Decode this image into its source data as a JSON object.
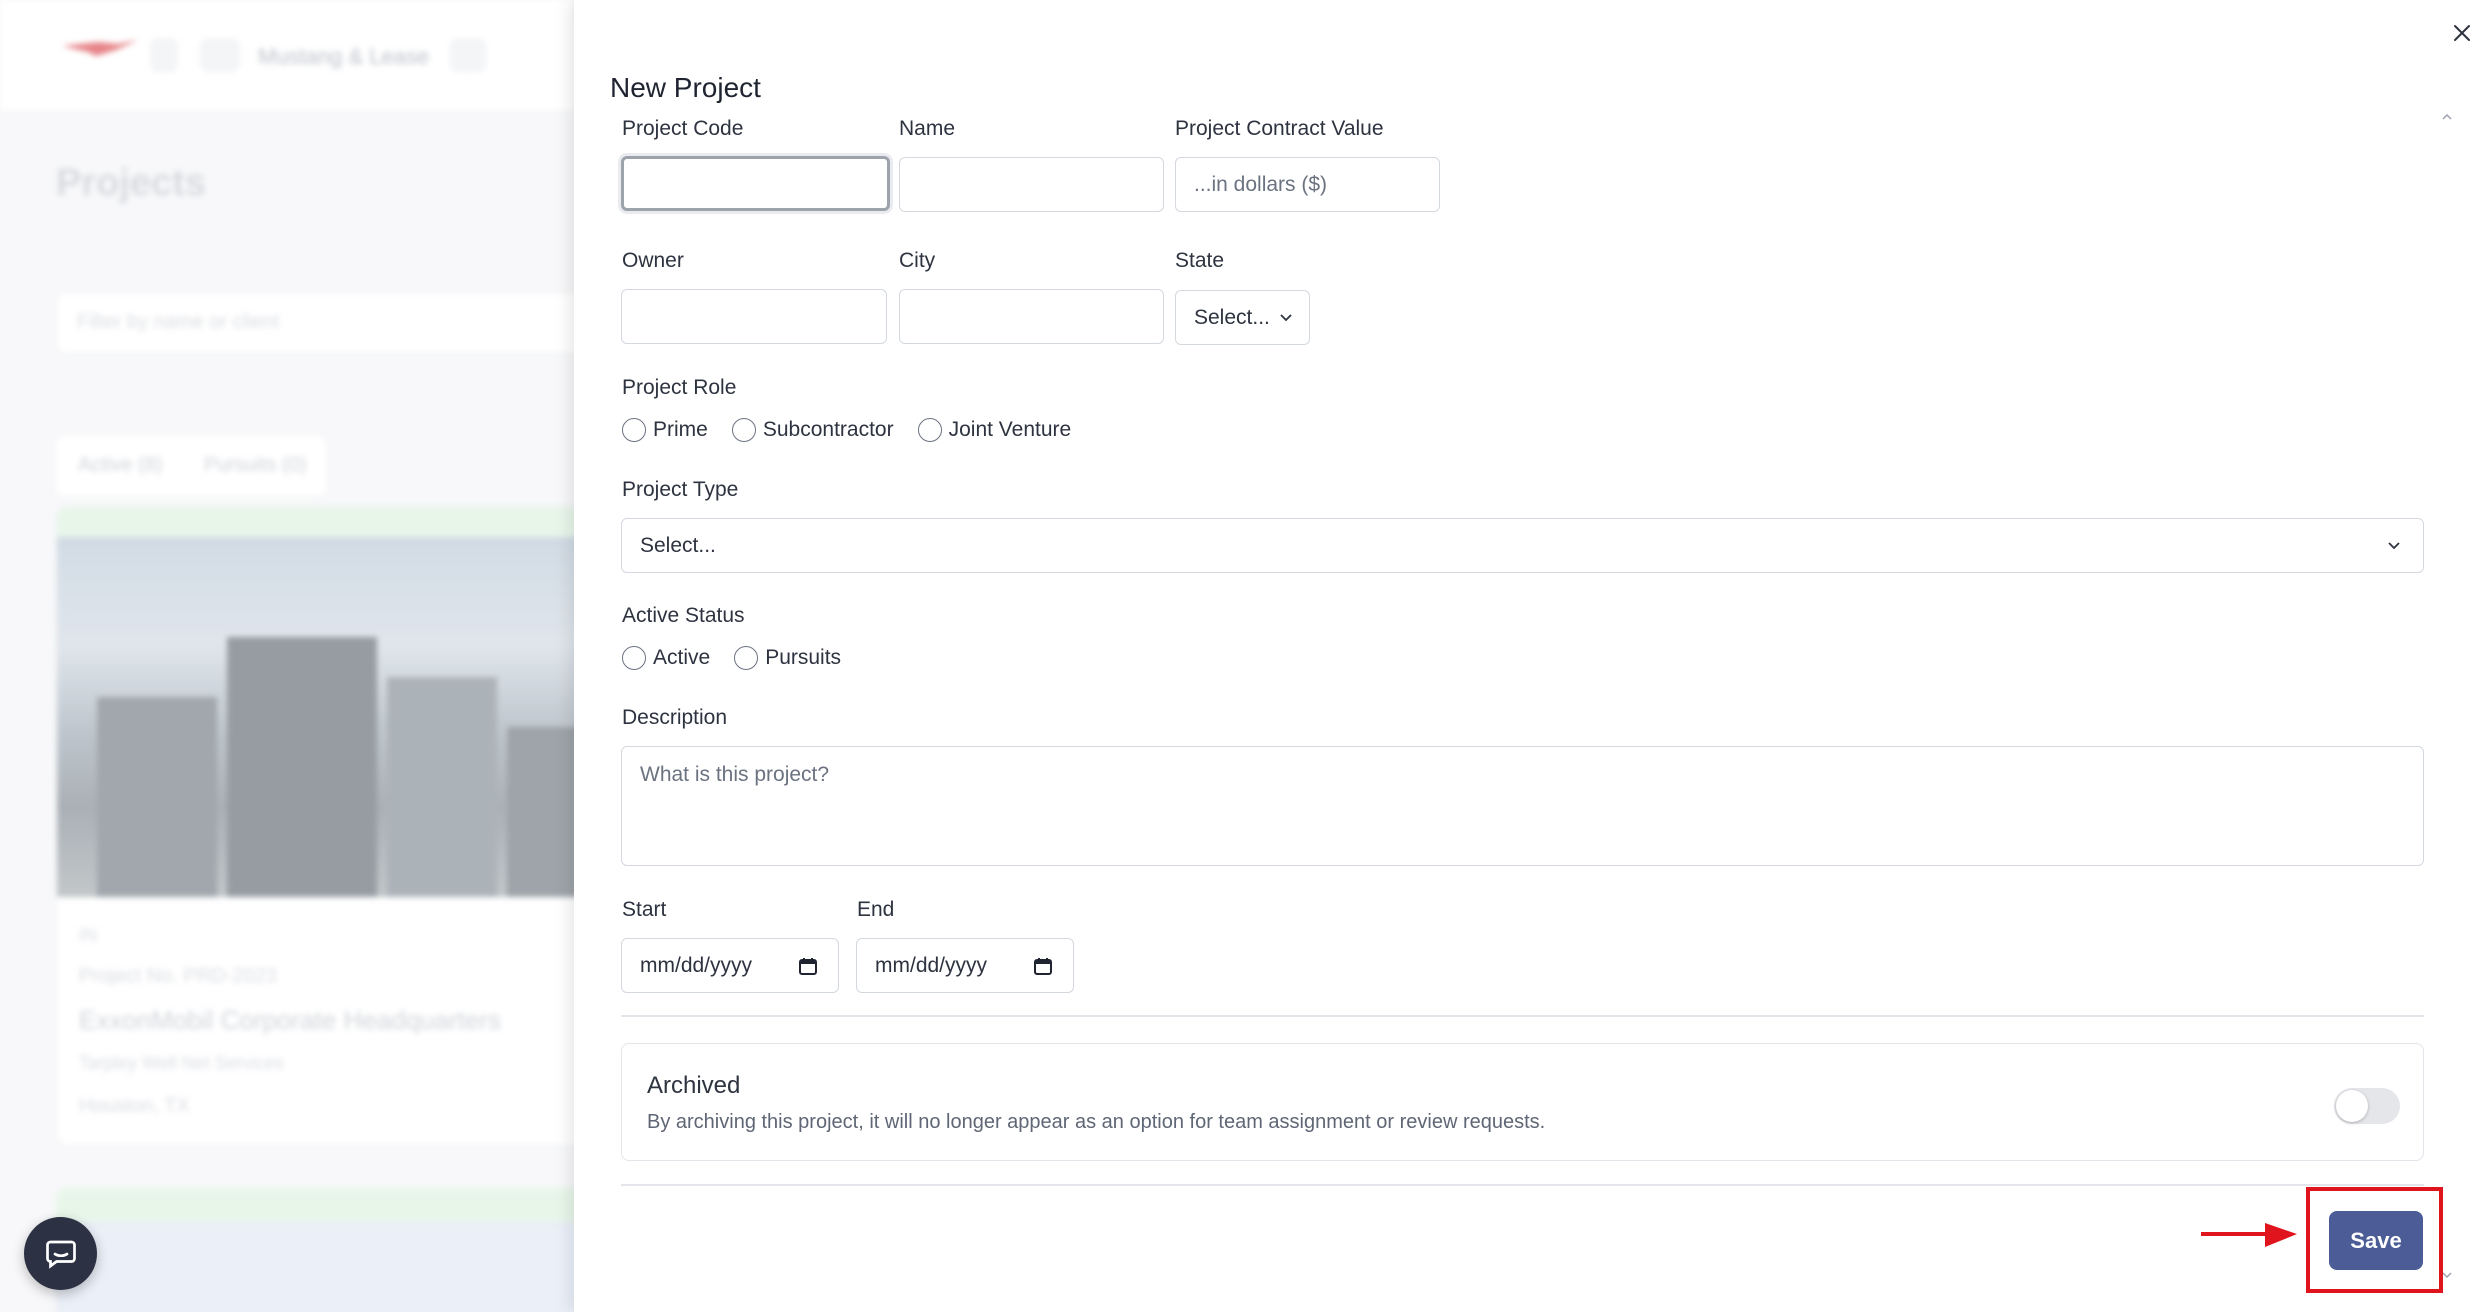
{
  "background": {
    "breadcrumb": "Mustang & Lease",
    "page_title": "Projects",
    "search_placeholder": "Filter by name or client",
    "tabs": [
      "Active (8)",
      "Pursuits (0)"
    ],
    "card": {
      "badge": "IN",
      "meta": "Project No. PRD-2023",
      "title": "ExxonMobil Corporate Headquarters",
      "tag": "Tarpley Well Net Services",
      "location": "Houston, TX"
    }
  },
  "panel": {
    "title": "New Project",
    "fields": {
      "project_code": {
        "label": "Project Code",
        "value": "",
        "placeholder": ""
      },
      "name": {
        "label": "Name",
        "value": "",
        "placeholder": ""
      },
      "contract_value": {
        "label": "Project Contract Value",
        "value": "",
        "placeholder": "...in dollars ($)"
      },
      "owner": {
        "label": "Owner",
        "value": "",
        "placeholder": ""
      },
      "city": {
        "label": "City",
        "value": "",
        "placeholder": ""
      },
      "state": {
        "label": "State",
        "selected": "Select..."
      },
      "project_role": {
        "label": "Project Role",
        "options": [
          "Prime",
          "Subcontractor",
          "Joint Venture"
        ]
      },
      "project_type": {
        "label": "Project Type",
        "selected": "Select..."
      },
      "active_status": {
        "label": "Active Status",
        "options": [
          "Active",
          "Pursuits"
        ]
      },
      "description": {
        "label": "Description",
        "value": "",
        "placeholder": "What is this project?"
      },
      "start": {
        "label": "Start",
        "value": "mm/dd/yyyy"
      },
      "end": {
        "label": "End",
        "value": "mm/dd/yyyy"
      }
    },
    "archived": {
      "title": "Archived",
      "description": "By archiving this project, it will no longer appear as an option for team assignment or review requests.",
      "enabled": false
    },
    "save_label": "Save"
  },
  "colors": {
    "primary_button": "#4b5c96",
    "annotation_red": "#e0141c",
    "border": "#d4d8df"
  },
  "icons": [
    "close-icon",
    "chevron-down-icon",
    "calendar-icon",
    "chat-icon",
    "chevron-up-icon",
    "arrow-right-icon"
  ]
}
